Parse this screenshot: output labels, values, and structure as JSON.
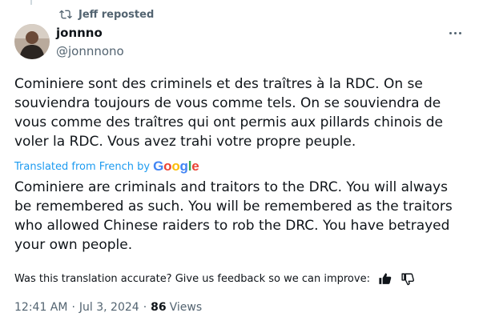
{
  "repost": {
    "text": "Jeff reposted",
    "icon": "repost-icon"
  },
  "author": {
    "name": "jonnno",
    "handle": "@jonnnono"
  },
  "tweet": {
    "original_text": "Cominiere sont des criminels et des traîtres à la RDC. On se souviendra toujours de vous comme tels. On se souviendra de vous comme des traîtres qui ont permis aux pillards chinois de voler la RDC. Vous avez trahi votre propre peuple.",
    "translated_from": "Translated from French by",
    "translator_brand": [
      "G",
      "o",
      "o",
      "g",
      "l",
      "e"
    ],
    "translated_text": "Cominiere are criminals and traitors to the DRC. You will always be remembered as such. You will be remembered as the traitors who allowed Chinese raiders to rob the DRC. You have betrayed your own people."
  },
  "feedback": {
    "prompt": "Was this translation accurate? Give us feedback so we can improve:"
  },
  "meta": {
    "time": "12:41 AM",
    "separator": "·",
    "date": "Jul 3, 2024",
    "views_count": "86",
    "views_label": "Views"
  },
  "colors": {
    "text_primary": "#0f1419",
    "text_secondary": "#536471",
    "link": "#1d9bf0",
    "google": [
      "#4285F4",
      "#EA4335",
      "#FBBC05",
      "#4285F4",
      "#34A853",
      "#EA4335"
    ]
  }
}
